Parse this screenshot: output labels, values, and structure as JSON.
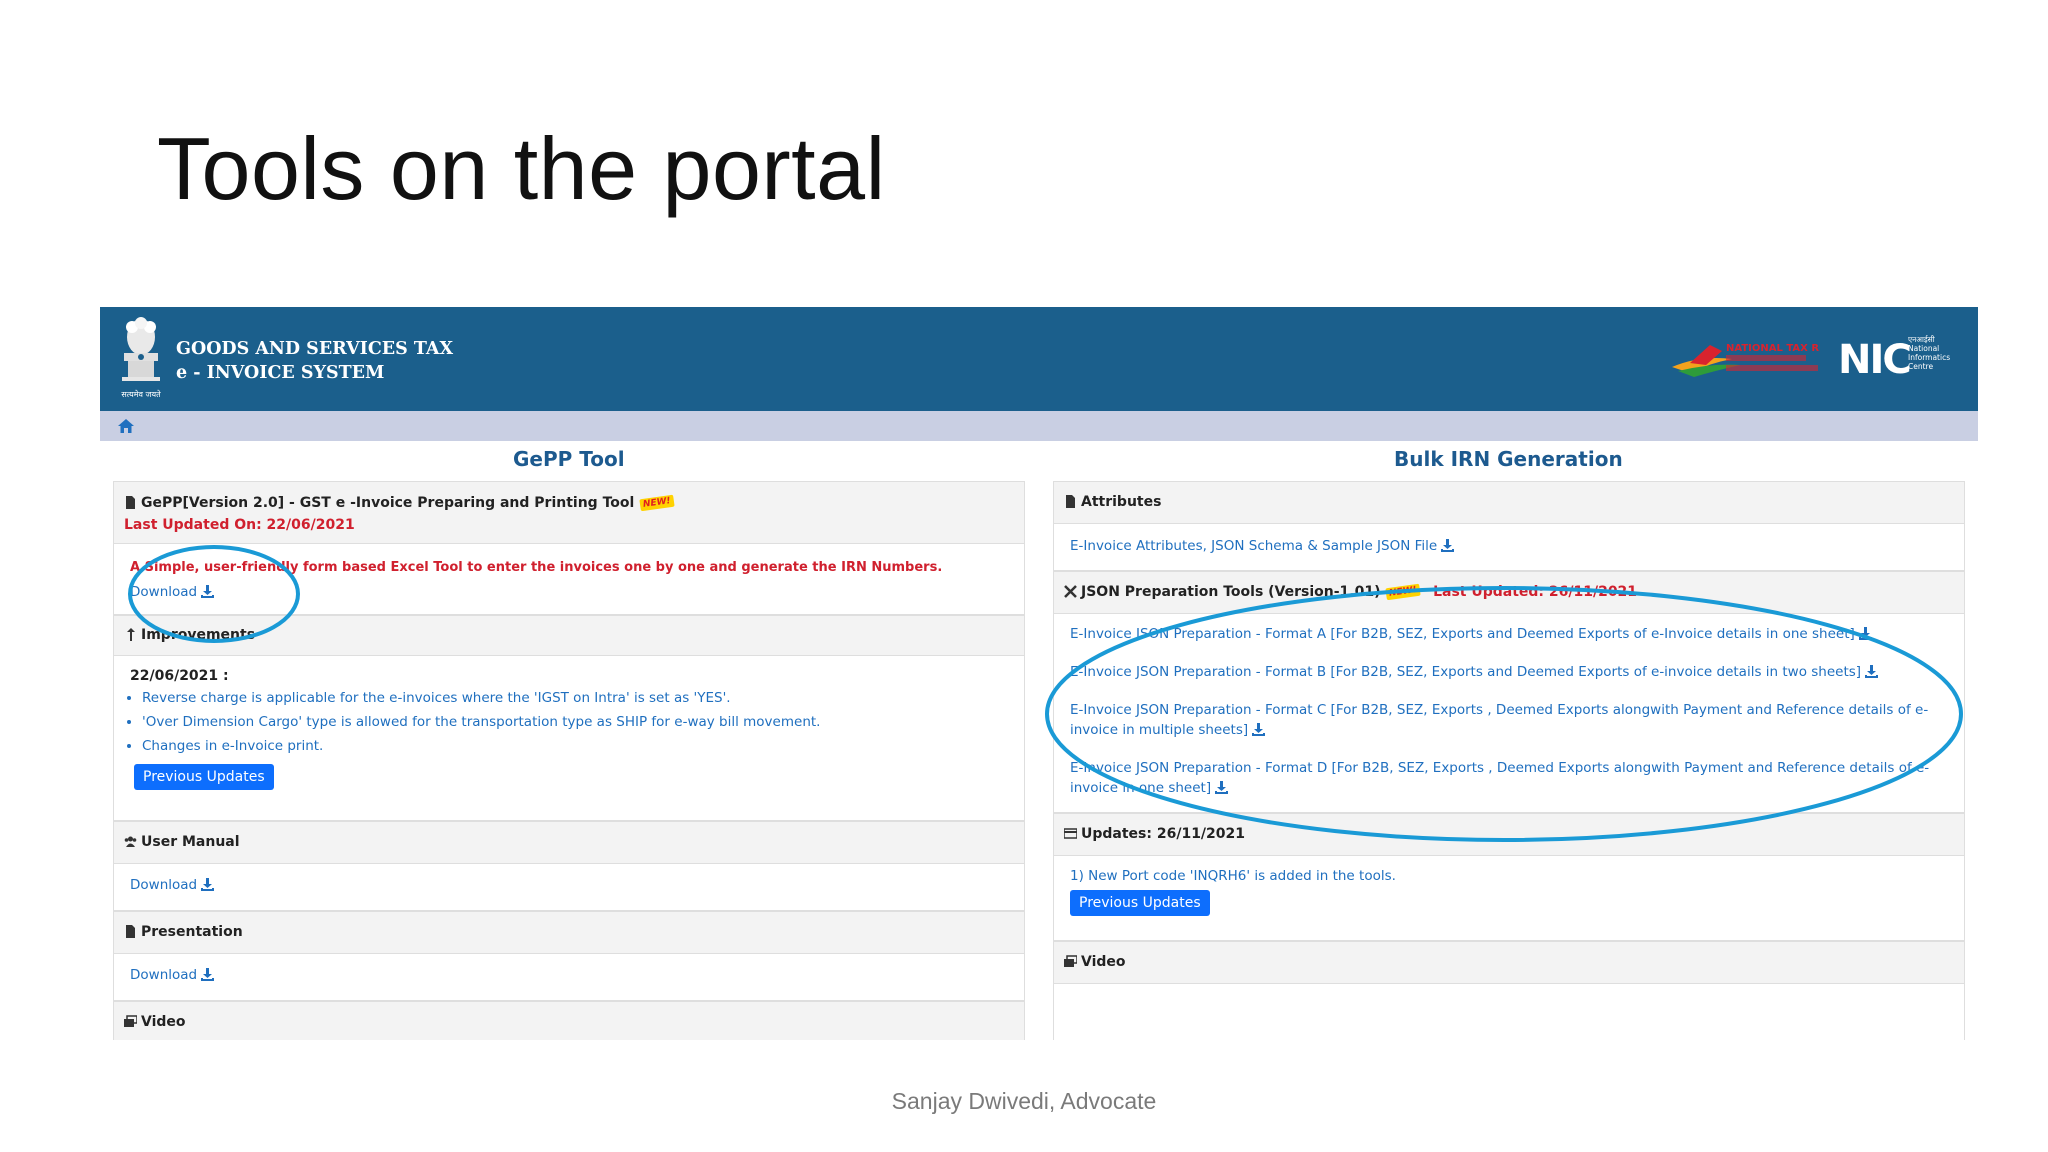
{
  "slide": {
    "title": "Tools on the portal",
    "footer": "Sanjay Dwivedi, Advocate"
  },
  "header": {
    "brand_line1": "GOODS AND SERVICES TAX",
    "brand_line2": "e - INVOICE SYSTEM",
    "emblem_caption": "सत्यमेव जयते",
    "ntr_logo_text": "NATIONAL TAX REGISTRY",
    "nic_logo_text": "NIC",
    "nic_sub1": "एनआईसी",
    "nic_sub2": "National",
    "nic_sub3": "Informatics",
    "nic_sub4": "Centre",
    "colors": {
      "header_bg": "#1b5f8c",
      "breadcrumb_bg": "#c9cfe3",
      "link": "#1f6fbf",
      "accent_red": "#d0202e",
      "button": "#0d6efd"
    }
  },
  "left": {
    "title": "GePP Tool",
    "gepp": {
      "heading": "GePP[Version 2.0] - GST e -Invoice Preparing and Printing Tool",
      "badge": "NEW!",
      "last_updated": "Last Updated On: 22/06/2021",
      "description": "A Simple, user-friendly form based Excel Tool to enter the invoices one by one and generate the IRN Numbers.",
      "download": "Download"
    },
    "improvements": {
      "heading": "Improvements",
      "date": "22/06/2021 :",
      "items": [
        "Reverse charge is applicable for the e-invoices where the 'IGST on Intra' is set as 'YES'.",
        "'Over Dimension Cargo' type is allowed for the transportation type as SHIP for e-way bill movement.",
        "Changes in e-Invoice print."
      ],
      "button": "Previous Updates"
    },
    "user_manual": {
      "heading": "User Manual",
      "download": "Download"
    },
    "presentation": {
      "heading": "Presentation",
      "download": "Download"
    },
    "video": {
      "heading": "Video"
    }
  },
  "right": {
    "title": "Bulk IRN Generation",
    "attributes": {
      "heading": "Attributes",
      "link": "E-Invoice Attributes, JSON Schema & Sample JSON File"
    },
    "json_tools": {
      "heading": "JSON Preparation Tools (Version-1.01)",
      "badge": "NEW!",
      "last_updated": "Last Updated: 26/11/2021",
      "items": [
        "E-Invoice JSON Preparation - Format A [For B2B, SEZ, Exports and Deemed Exports of e-Invoice details in one sheet]",
        "E-Invoice JSON Preparation - Format B [For B2B, SEZ, Exports and Deemed Exports of e-invoice details in two sheets]",
        "E-Invoice JSON Preparation - Format C [For B2B, SEZ, Exports , Deemed Exports alongwith Payment and Reference details of e-invoice in multiple sheets]",
        "E-Invoice JSON Preparation - Format D [For B2B, SEZ, Exports , Deemed Exports alongwith Payment and Reference details of e-invoice in one sheet]"
      ]
    },
    "updates": {
      "heading": "Updates: 26/11/2021",
      "item": "1) New Port code 'INQRH6' is added in the tools.",
      "button": "Previous Updates"
    },
    "video": {
      "heading": "Video"
    }
  }
}
